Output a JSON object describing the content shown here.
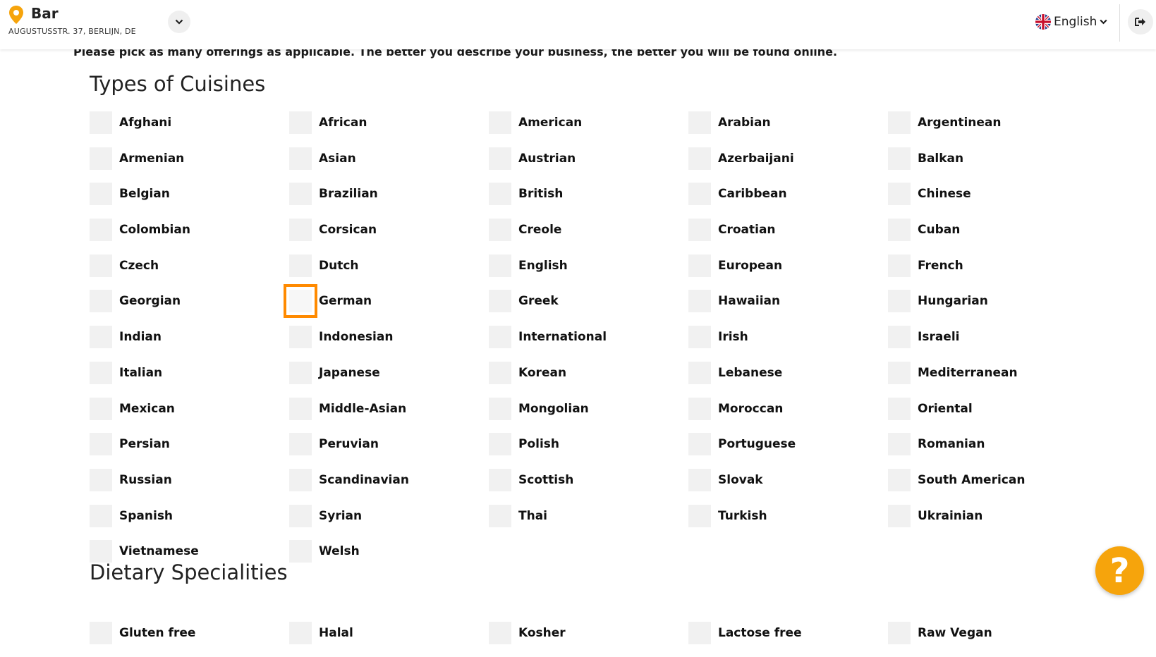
{
  "header": {
    "location_name": "Bar",
    "location_address": "AUGUSTUSSTR. 37, BERLIJN, DE",
    "language": "English"
  },
  "intro_text": "Please pick as many offerings as applicable. The better you describe your business, the better you will be found online.",
  "cuisines": {
    "title": "Types of Cuisines",
    "options": [
      "Afghani",
      "African",
      "American",
      "Arabian",
      "Argentinean",
      "Armenian",
      "Asian",
      "Austrian",
      "Azerbaijani",
      "Balkan",
      "Belgian",
      "Brazilian",
      "British",
      "Caribbean",
      "Chinese",
      "Colombian",
      "Corsican",
      "Creole",
      "Croatian",
      "Cuban",
      "Czech",
      "Dutch",
      "English",
      "European",
      "French",
      "Georgian",
      "German",
      "Greek",
      "Hawaiian",
      "Hungarian",
      "Indian",
      "Indonesian",
      "International",
      "Irish",
      "Israeli",
      "Italian",
      "Japanese",
      "Korean",
      "Lebanese",
      "Mediterranean",
      "Mexican",
      "Middle-Asian",
      "Mongolian",
      "Moroccan",
      "Oriental",
      "Persian",
      "Peruvian",
      "Polish",
      "Portuguese",
      "Romanian",
      "Russian",
      "Scandinavian",
      "Scottish",
      "Slovak",
      "South American",
      "Spanish",
      "Syrian",
      "Thai",
      "Turkish",
      "Ukrainian",
      "Vietnamese",
      "Welsh"
    ],
    "focused_option": "German"
  },
  "dietary": {
    "title": "Dietary Specialities",
    "options": [
      "Gluten free",
      "Halal",
      "Kosher",
      "Lactose free",
      "Raw Vegan"
    ]
  },
  "help_button": {
    "glyph": "?"
  },
  "icons": {
    "location": "map-pin-icon",
    "toggle": "chevron-down-icon",
    "flag": "uk-flag-icon",
    "logout": "logout-icon",
    "help": "question-mark-icon"
  },
  "colors": {
    "accent": "#f6a40c",
    "focus": "#ff8a00",
    "checkbox": "#f1f1f1"
  }
}
